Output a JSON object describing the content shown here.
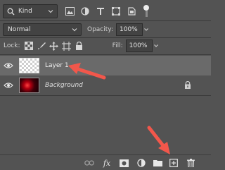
{
  "filter": {
    "kind_label": "Kind",
    "icons": [
      "search-icon",
      "pixel-layer-filter-icon",
      "adjustment-layer-filter-icon",
      "type-layer-filter-icon",
      "shape-layer-filter-icon",
      "smart-object-filter-icon",
      "filter-toggle-icon"
    ]
  },
  "blend": {
    "mode": "Normal",
    "opacity_label": "Opacity:",
    "opacity_value": "100%"
  },
  "lock": {
    "label": "Lock:",
    "fill_label": "Fill:",
    "fill_value": "100%"
  },
  "layers": [
    {
      "name": "Layer 1",
      "selected": true,
      "visible": true
    },
    {
      "name": "Background",
      "selected": false,
      "visible": true,
      "locked": true
    }
  ],
  "bottom_bar": {
    "icons": [
      "link-layers-icon",
      "fx-icon",
      "add-mask-icon",
      "adjustment-layer-icon",
      "new-group-icon",
      "new-layer-icon",
      "delete-layer-icon"
    ],
    "fx_label": "fx"
  },
  "colors": {
    "panel_bg": "#535353",
    "selected_row": "#6a6a6a",
    "annotation_arrow": "#f2574b"
  }
}
